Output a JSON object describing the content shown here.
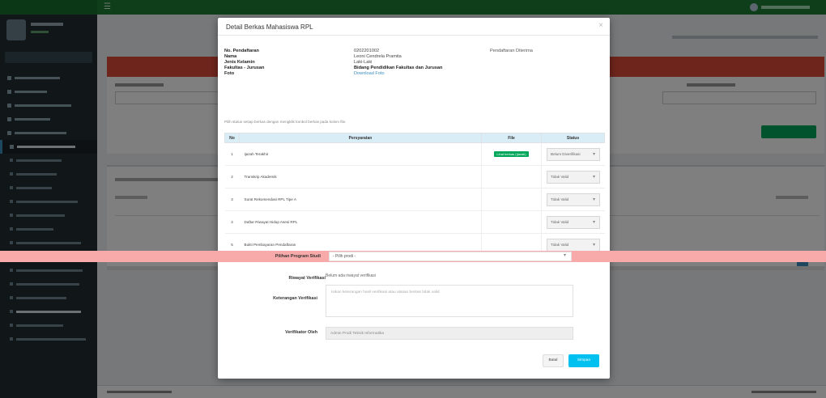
{
  "modal": {
    "title": "Detail Berkas Mahasiswa RPL",
    "close_glyph": "×",
    "info": {
      "labels": [
        "No. Pendaftaran",
        "Nama",
        "Jenis Kelamin",
        "Fakultas - Jurusan",
        "Foto"
      ],
      "values": [
        "0202201002",
        "Leoni Cendrela Pramita",
        "Laki-Laki",
        "Bidang Pendidikan Fakultas dan Jurusan",
        "Download Foto"
      ],
      "extra": "Pendaftaran Diterima"
    },
    "note": "Pilih status setiap berkas dengan mengklik tombol berkas pada kolom file.",
    "table": {
      "headers": [
        "No",
        "Persyaratan",
        "File",
        "Status"
      ],
      "rows": [
        {
          "no": "1",
          "name": "Ijazah Terakhir",
          "file": "Lihat berkas (Ijazah)",
          "status": "Belum Diverifikasi"
        },
        {
          "no": "2",
          "name": "Transkrip Akademik",
          "file": "",
          "status": "Tidak Valid"
        },
        {
          "no": "3",
          "name": "Surat Rekomendasi RPL Tipe A",
          "file": "",
          "status": "Tidak Valid"
        },
        {
          "no": "4",
          "name": "Daftar Riwayat Hidup Asesi RPL",
          "file": "",
          "status": "Tidak Valid"
        },
        {
          "no": "5",
          "name": "Bukti Pembayaran Pendaftaran",
          "file": "",
          "status": "Tidak Valid"
        }
      ]
    },
    "prodi": {
      "label": "Pilihan Program Studi",
      "value": "- Pilih prodi -"
    },
    "riwayat": {
      "label": "Riwayat Verifikasi",
      "value": "Belum ada riwayat verifikasi"
    },
    "ket": {
      "label": "Keterangan Verifikasi",
      "placeholder": "Isikan keterangan hasil verifikasi atau alasan berkas tidak valid"
    },
    "verif": {
      "label": "Verifikator Oleh",
      "value": "Admin Prodi Teknik Informatika"
    },
    "buttons": {
      "cancel": "Batal",
      "save": "Simpan"
    }
  },
  "colors": {
    "header": "#1e7e34",
    "sidebar": "#222d32",
    "accent_red": "#dd4b39",
    "info_blue": "#00c0ef",
    "success": "#00a65a"
  }
}
